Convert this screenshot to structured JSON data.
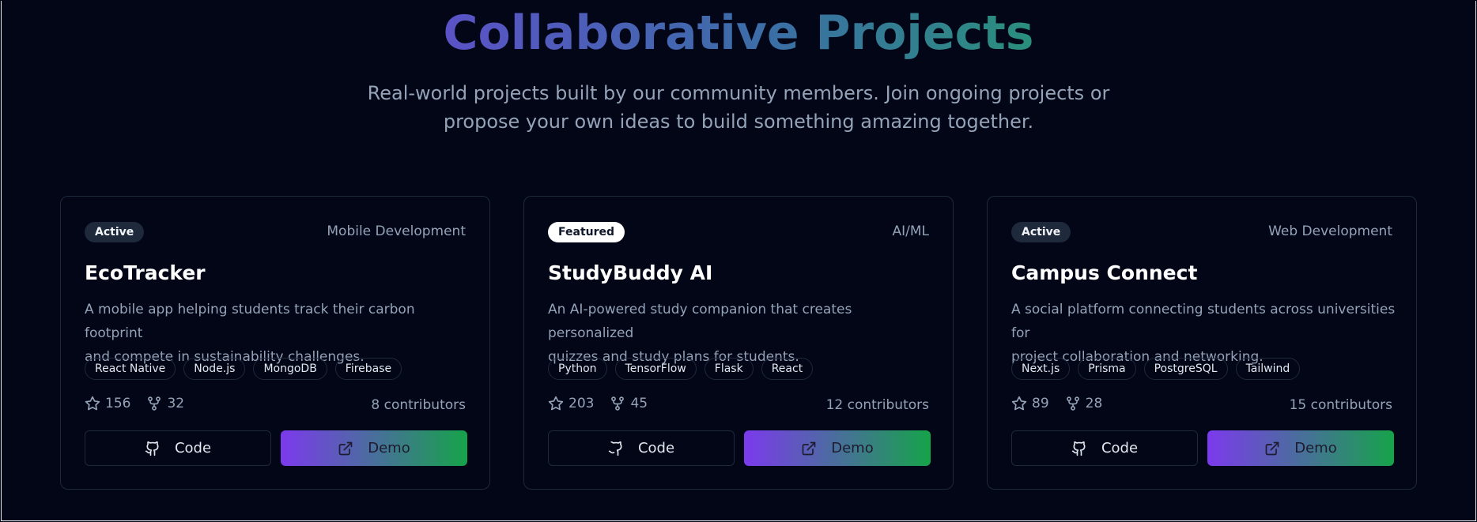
{
  "header": {
    "title": "Collaborative Projects",
    "subtitle_line1": "Real-world projects built by our community members. Join ongoing projects or",
    "subtitle_line2": "propose your own ideas to build something amazing together."
  },
  "colors": {
    "background": "#020617",
    "card_border": "#1e293b",
    "demo_gradient_start": "#7c3aed",
    "demo_gradient_end": "#16a34a"
  },
  "projects": [
    {
      "badge": "Active",
      "category": "Mobile Development",
      "title": "EcoTracker",
      "description_line1": "A mobile app helping students track their carbon footprint",
      "description_line2": "and compete in sustainability challenges.",
      "tags": [
        "React Native",
        "Node.js",
        "MongoDB",
        "Firebase"
      ],
      "stars": "156",
      "forks": "32",
      "contributors": "8 contributors",
      "code_label": "Code",
      "demo_label": "Demo"
    },
    {
      "badge": "Featured",
      "category": "AI/ML",
      "title": "StudyBuddy AI",
      "description_line1": "An AI-powered study companion that creates personalized",
      "description_line2": "quizzes and study plans for students.",
      "tags": [
        "Python",
        "TensorFlow",
        "Flask",
        "React"
      ],
      "stars": "203",
      "forks": "45",
      "contributors": "12 contributors",
      "code_label": "Code",
      "demo_label": "Demo"
    },
    {
      "badge": "Active",
      "category": "Web Development",
      "title": "Campus Connect",
      "description_line1": "A social platform connecting students across universities for",
      "description_line2": "project collaboration and networking.",
      "tags": [
        "Next.js",
        "Prisma",
        "PostgreSQL",
        "Tailwind"
      ],
      "stars": "89",
      "forks": "28",
      "contributors": "15 contributors",
      "code_label": "Code",
      "demo_label": "Demo"
    }
  ]
}
